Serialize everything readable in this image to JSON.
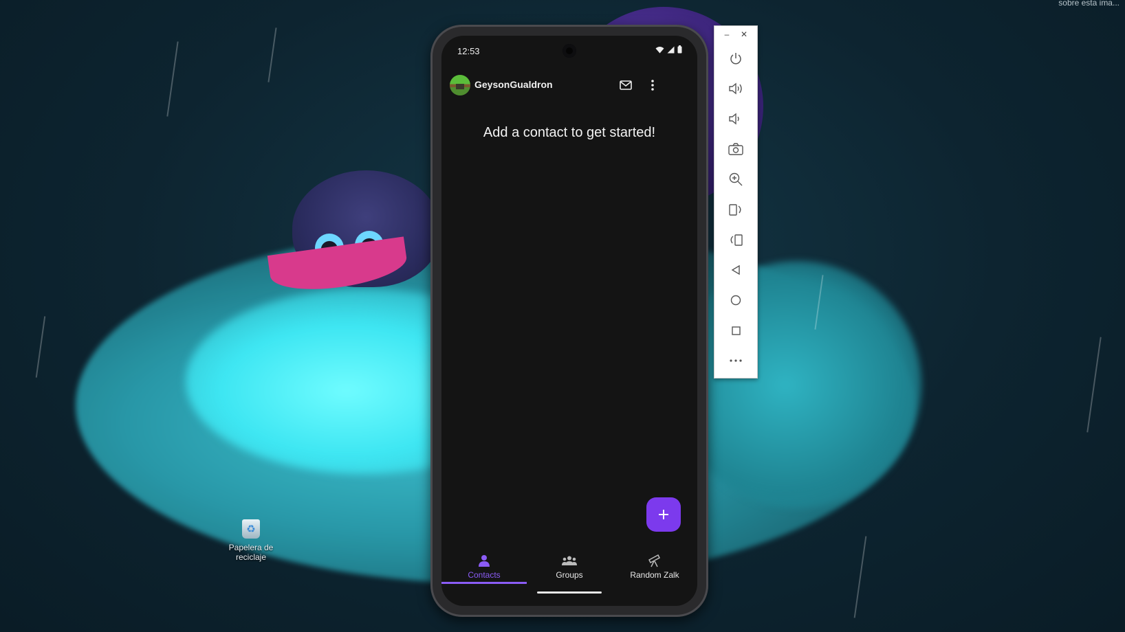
{
  "desktop": {
    "corner_text": "sobre esta ima...",
    "recycle_bin_label": "Papelera de reciclaje"
  },
  "phone": {
    "status_bar": {
      "time": "12:53"
    },
    "app_bar": {
      "username": "GeysonGualdron"
    },
    "empty_state": "Add a contact to get started!",
    "fab_icon": "plus-icon",
    "bottom_nav": {
      "items": [
        {
          "label": "Contacts",
          "icon": "person-icon",
          "active": true
        },
        {
          "label": "Groups",
          "icon": "group-icon",
          "active": false
        },
        {
          "label": "Random Zalk",
          "icon": "telescope-icon",
          "active": false
        }
      ]
    }
  },
  "emulator_toolbar": {
    "minimize": "–",
    "close": "✕",
    "buttons": [
      "power-icon",
      "volume-up-icon",
      "volume-down-icon",
      "camera-icon",
      "zoom-in-icon",
      "rotate-left-icon",
      "rotate-right-icon",
      "back-icon",
      "home-icon",
      "overview-icon",
      "more-icon"
    ]
  },
  "colors": {
    "accent": "#7c3aed",
    "nav_active": "#8b5cf6",
    "screen_bg": "#141414"
  }
}
